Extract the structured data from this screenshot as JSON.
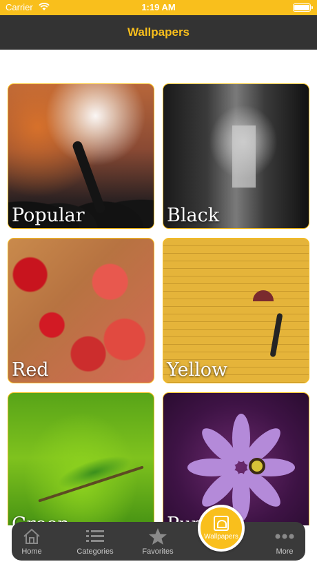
{
  "status_bar": {
    "carrier": "Carrier",
    "time": "1:19 AM"
  },
  "nav": {
    "title": "Wallpapers"
  },
  "colors": {
    "accent": "#f9bf1c",
    "navbar": "#333333",
    "tabbar": "#3a3a3a"
  },
  "categories": [
    {
      "label": "Popular"
    },
    {
      "label": "Black"
    },
    {
      "label": "Red"
    },
    {
      "label": "Yellow"
    },
    {
      "label": "Green"
    },
    {
      "label": "Purple"
    }
  ],
  "tab_bar": {
    "items": [
      {
        "label": "Home",
        "icon": "home-icon"
      },
      {
        "label": "Categories",
        "icon": "list-icon"
      },
      {
        "label": "Favorites",
        "icon": "star-icon"
      },
      {
        "label": "Wallpapers",
        "icon": "wallpaper-icon"
      },
      {
        "label": "More",
        "icon": "ellipsis-icon"
      }
    ],
    "selected": "Wallpapers"
  }
}
